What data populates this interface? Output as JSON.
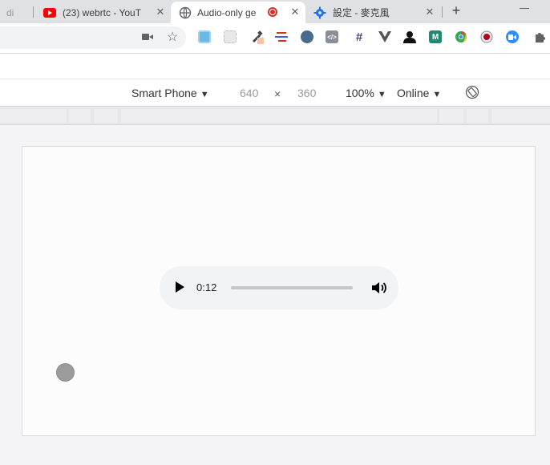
{
  "tabs": [
    {
      "title": "di",
      "icon": "page-icon"
    },
    {
      "title": "(23) webrtc - YouT",
      "icon": "youtube-icon"
    },
    {
      "title": "Audio-only ge",
      "icon": "globe-icon",
      "active": true,
      "recording": true
    },
    {
      "title": "設定 - 麥克風",
      "icon": "settings-gear-icon"
    }
  ],
  "device_toolbar": {
    "device": "Smart Phone",
    "width": "640",
    "times": "×",
    "height": "360",
    "zoom": "100%",
    "throttling": "Online"
  },
  "audio_player": {
    "current_time": "0:12",
    "progress": 0
  },
  "colors": {
    "tab_strip": "#dfe1e5",
    "youtube_red": "#ff0000",
    "settings_blue": "#1a73e8",
    "record_red": "#d93025"
  }
}
